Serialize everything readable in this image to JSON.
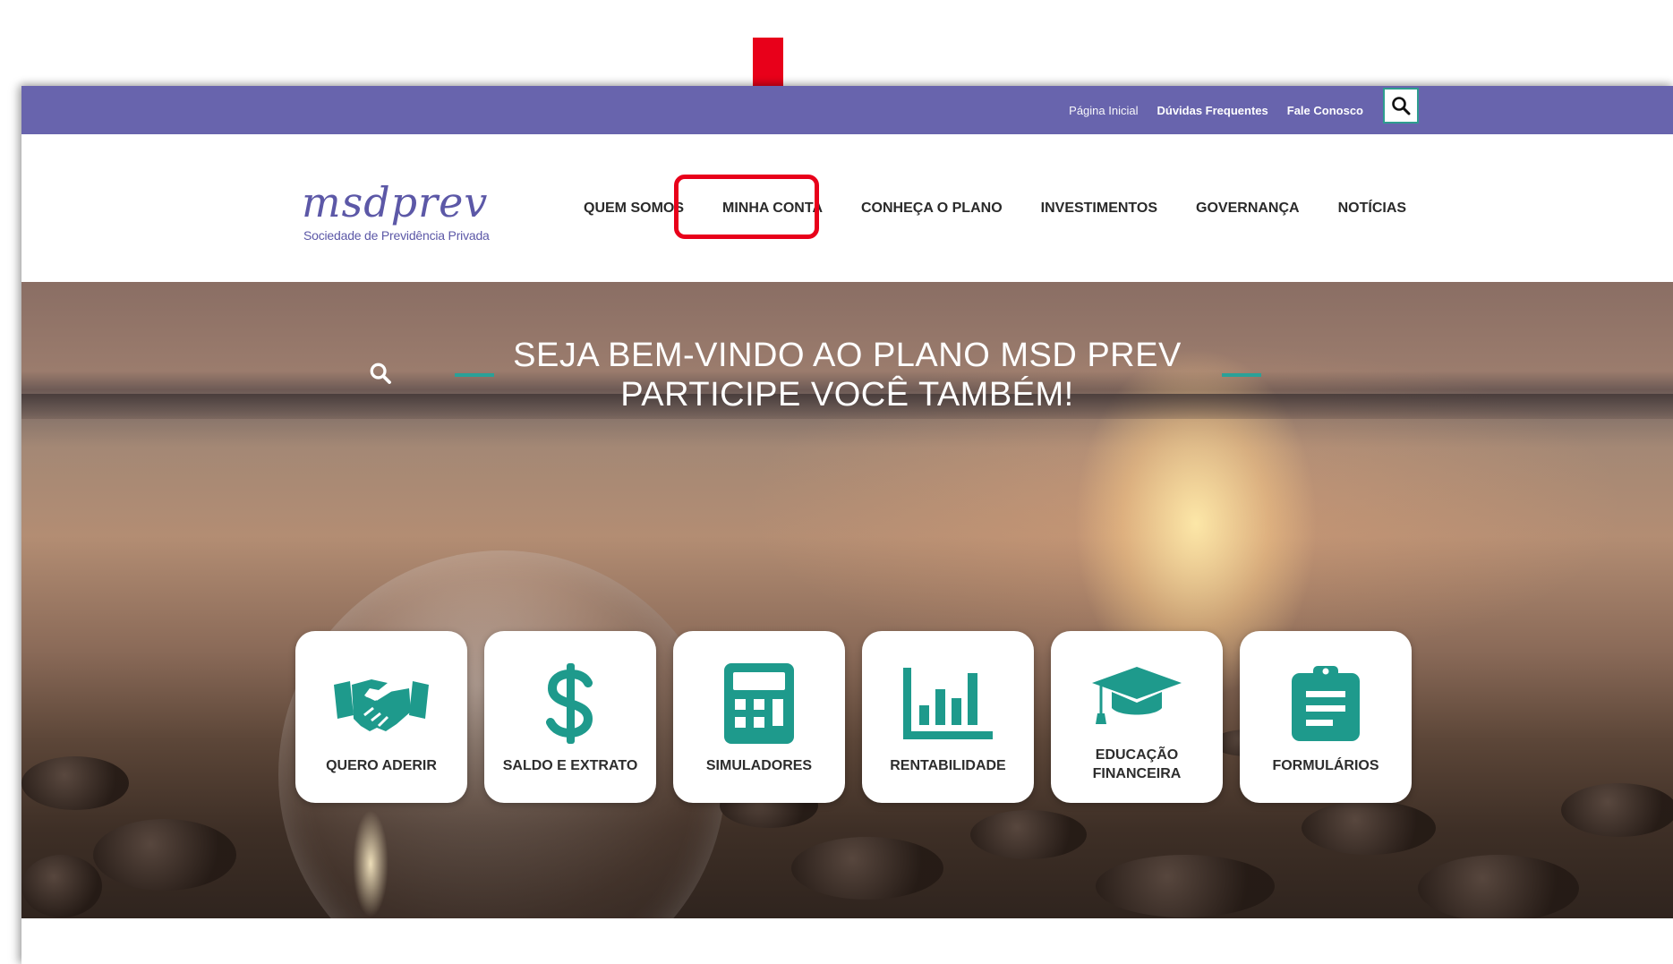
{
  "colors": {
    "topbar": "#6864ad",
    "accent_teal": "#1e9a8c",
    "highlight_red": "#e8001a",
    "logo_purple": "#5c58a7"
  },
  "topbar": {
    "links": [
      "Página Inicial",
      "Dúvidas Frequentes",
      "Fale Conosco"
    ],
    "search_icon": "search-icon"
  },
  "logo": {
    "main": "msdprev",
    "subtitle": "Sociedade de Previdência Privada"
  },
  "nav": {
    "items": [
      "QUEM SOMOS",
      "MINHA CONTA",
      "CONHEÇA O PLANO",
      "INVESTIMENTOS",
      "GOVERNANÇA",
      "NOTÍCIAS"
    ],
    "highlighted": "MINHA CONTA"
  },
  "hero": {
    "line1": "SEJA BEM-VINDO AO PLANO MSD PREV",
    "line2": "PARTICIPE VOCÊ TAMBÉM!",
    "search_icon": "search-icon"
  },
  "cards": [
    {
      "icon": "handshake-icon",
      "line1": "QUERO ADERIR",
      "line2": ""
    },
    {
      "icon": "dollar-icon",
      "line1": "SALDO E EXTRATO",
      "line2": ""
    },
    {
      "icon": "calculator-icon",
      "line1": "SIMULADORES",
      "line2": ""
    },
    {
      "icon": "bar-chart-icon",
      "line1": "RENTABILIDADE",
      "line2": ""
    },
    {
      "icon": "graduation-cap-icon",
      "line1": "EDUCAÇÃO",
      "line2": "FINANCEIRA"
    },
    {
      "icon": "clipboard-icon",
      "line1": "FORMULÁRIOS",
      "line2": ""
    }
  ]
}
